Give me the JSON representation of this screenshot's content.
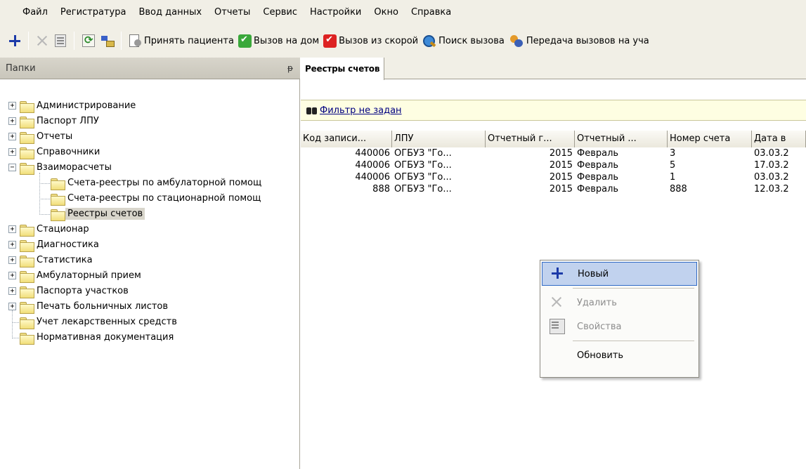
{
  "menubar": {
    "items": [
      "Файл",
      "Регистратура",
      "Ввод данных",
      "Отчеты",
      "Сервис",
      "Настройки",
      "Окно",
      "Справка"
    ]
  },
  "toolbar": {
    "accept_patient": "Принять пациента",
    "home_call": "Вызов на дом",
    "ambulance_call": "Вызов из скорой",
    "call_search": "Поиск вызова",
    "transfer_calls": "Передача вызовов на уча"
  },
  "left_panel": {
    "title": "Папки",
    "pin_icon": "pin-icon",
    "tree": [
      {
        "label": "Администрирование",
        "level": 0,
        "expander": "+"
      },
      {
        "label": "Паспорт ЛПУ",
        "level": 0,
        "expander": "+"
      },
      {
        "label": "Отчеты",
        "level": 0,
        "expander": "+"
      },
      {
        "label": "Справочники",
        "level": 0,
        "expander": "+"
      },
      {
        "label": "Взаиморасчеты",
        "level": 0,
        "expander": "−"
      },
      {
        "label": "Счета-реестры по амбулаторной помощ",
        "level": 1,
        "expander": ""
      },
      {
        "label": "Счета-реестры по стационарной помощ",
        "level": 1,
        "expander": ""
      },
      {
        "label": "Реестры счетов",
        "level": 1,
        "expander": "",
        "selected": true
      },
      {
        "label": "Стационар",
        "level": 0,
        "expander": "+"
      },
      {
        "label": "Диагностика",
        "level": 0,
        "expander": "+"
      },
      {
        "label": "Статистика",
        "level": 0,
        "expander": "+"
      },
      {
        "label": "Амбулаторный прием",
        "level": 0,
        "expander": "+"
      },
      {
        "label": "Паспорта участков",
        "level": 0,
        "expander": "+"
      },
      {
        "label": "Печать больничных листов",
        "level": 0,
        "expander": "+"
      },
      {
        "label": "Учет лекарственных средств",
        "level": 0,
        "expander": ""
      },
      {
        "label": "Нормативная документация",
        "level": 0,
        "expander": ""
      }
    ]
  },
  "right_panel": {
    "tab_label": "Реестры счетов",
    "filter_text": "Фильтр не задан",
    "columns": [
      "Код записи...",
      "ЛПУ",
      "Отчетный г...",
      "Отчетный ...",
      "Номер счета",
      "Дата в"
    ],
    "rows": [
      [
        "440006",
        "ОГБУЗ \"Го...",
        "2015",
        "Февраль",
        "3",
        "03.03.2"
      ],
      [
        "440006",
        "ОГБУЗ \"Го...",
        "2015",
        "Февраль",
        "5",
        "17.03.2"
      ],
      [
        "440006",
        "ОГБУЗ \"Го...",
        "2015",
        "Февраль",
        "1",
        "03.03.2"
      ],
      [
        "888",
        "ОГБУЗ \"Го...",
        "2015",
        "Февраль",
        "888",
        "12.03.2"
      ]
    ]
  },
  "context_menu": {
    "new": "Новый",
    "delete": "Удалить",
    "properties": "Свойства",
    "refresh": "Обновить"
  },
  "colors": {
    "chrome": "#f1efe6",
    "accent_blue": "#1c3aa8",
    "menu_highlight": "#c1d2ee",
    "filter_bg": "#fefee2"
  }
}
